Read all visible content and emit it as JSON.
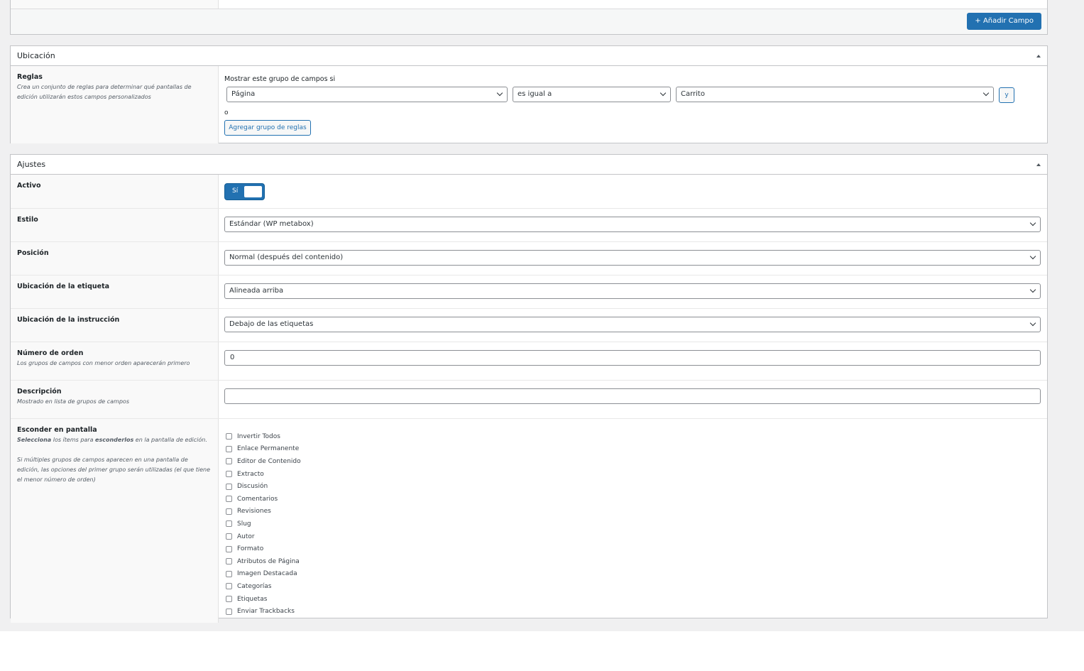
{
  "top": {
    "add_field_label": "+ Añadir Campo"
  },
  "location": {
    "title": "Ubicación",
    "rules_label": "Reglas",
    "rules_desc": "Crea un conjunto de reglas para determinar qué pantallas de edición utilizarán estos campos personalizados",
    "show_if": "Mostrar este grupo de campos si",
    "param": "Página",
    "operator": "es igual a",
    "value": "Carrito",
    "and_label": "y",
    "or_label": "o",
    "add_rule_group": "Agregar grupo de reglas"
  },
  "settings": {
    "title": "Ajustes",
    "active_label": "Activo",
    "active_value": "Sí",
    "style_label": "Estilo",
    "style_value": "Estándar (WP metabox)",
    "position_label": "Posición",
    "position_value": "Normal (después del contenido)",
    "label_placement_label": "Ubicación de la etiqueta",
    "label_placement_value": "Alineada arriba",
    "instruction_placement_label": "Ubicación de la instrucción",
    "instruction_placement_value": "Debajo de las etiquetas",
    "order_label": "Número de orden",
    "order_desc": "Los grupos de campos con menor orden aparecerán primero",
    "order_value": "0",
    "description_label": "Descripción",
    "description_desc": "Mostrado en lista de grupos de campos",
    "description_value": "",
    "hide_label": "Esconder en pantalla",
    "hide_desc_1_pre": "Selecciona",
    "hide_desc_1_mid": " los ítems para ",
    "hide_desc_1_bold": "esconderlos",
    "hide_desc_1_post": " en la pantalla de edición.",
    "hide_desc_2": "Si múltiples grupos de campos aparecen en una pantalla de edición, las opciones del primer grupo serán utilizadas (el que tiene el menor número de orden)",
    "hide_items": [
      "Invertir Todos",
      "Enlace Permanente",
      "Editor de Contenido",
      "Extracto",
      "Discusión",
      "Comentarios",
      "Revisiones",
      "Slug",
      "Autor",
      "Formato",
      "Atributos de Página",
      "Imagen Destacada",
      "Categorías",
      "Etiquetas",
      "Enviar Trackbacks"
    ]
  }
}
